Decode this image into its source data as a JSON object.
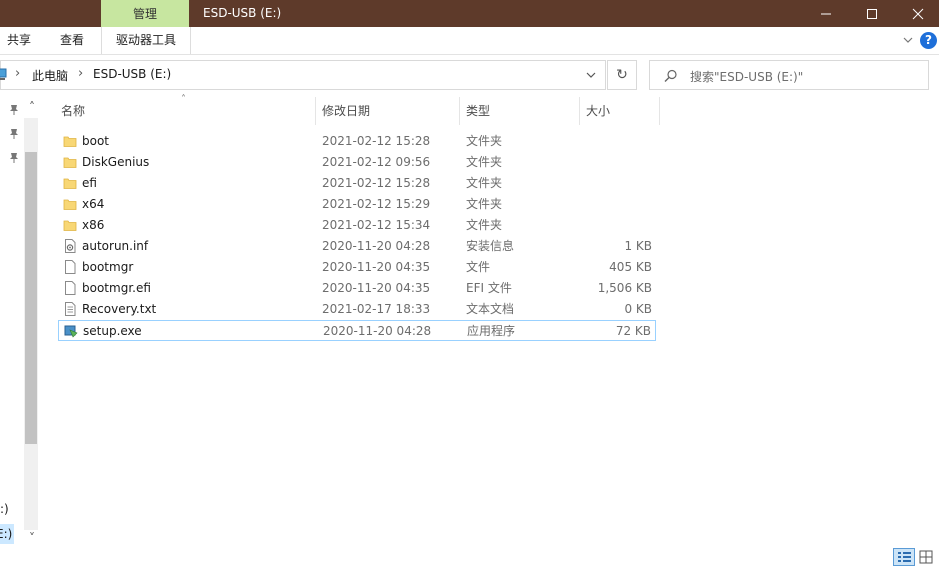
{
  "titlebar": {
    "context_tab": "管理",
    "title": "ESD-USB (E:)",
    "minimize": "—",
    "maximize": "☐",
    "close": "✕"
  },
  "ribbon": {
    "tabs": [
      "共享",
      "查看",
      "驱动器工具"
    ],
    "help": "?",
    "expand": "∨"
  },
  "address": {
    "crumbs": [
      "此电脑",
      "ESD-USB (E:)"
    ],
    "sep": "›",
    "dropdown": "∨",
    "refresh": "↻",
    "search_placeholder": "搜索\"ESD-USB (E:)\""
  },
  "nav": {
    "partial_items": [
      ":)",
      "E:)"
    ],
    "scroll_up": "˄",
    "scroll_down": "˅"
  },
  "columns": {
    "name": "名称",
    "date": "修改日期",
    "type": "类型",
    "size": "大小",
    "sort_arrow": "˄"
  },
  "files": [
    {
      "name": "boot",
      "date": "2021-02-12 15:28",
      "type": "文件夹",
      "size": "",
      "icon": "folder-icon"
    },
    {
      "name": "DiskGenius",
      "date": "2021-02-12 09:56",
      "type": "文件夹",
      "size": "",
      "icon": "folder-icon"
    },
    {
      "name": "efi",
      "date": "2021-02-12 15:28",
      "type": "文件夹",
      "size": "",
      "icon": "folder-icon"
    },
    {
      "name": "x64",
      "date": "2021-02-12 15:29",
      "type": "文件夹",
      "size": "",
      "icon": "folder-icon"
    },
    {
      "name": "x86",
      "date": "2021-02-12 15:34",
      "type": "文件夹",
      "size": "",
      "icon": "folder-icon"
    },
    {
      "name": "autorun.inf",
      "date": "2020-11-20 04:28",
      "type": "安装信息",
      "size": "1 KB",
      "icon": "settings-file-icon"
    },
    {
      "name": "bootmgr",
      "date": "2020-11-20 04:35",
      "type": "文件",
      "size": "405 KB",
      "icon": "file-icon"
    },
    {
      "name": "bootmgr.efi",
      "date": "2020-11-20 04:35",
      "type": "EFI 文件",
      "size": "1,506 KB",
      "icon": "file-icon"
    },
    {
      "name": "Recovery.txt",
      "date": "2021-02-17 18:33",
      "type": "文本文档",
      "size": "0 KB",
      "icon": "text-file-icon"
    },
    {
      "name": "setup.exe",
      "date": "2020-11-20 04:28",
      "type": "应用程序",
      "size": "72 KB",
      "icon": "setup-app-icon",
      "selected": true
    }
  ],
  "colors": {
    "titlebar": "#5e3a2a",
    "context_tab": "#c7e6a0",
    "folder": "#f8d775",
    "selection_border": "#99d1ff",
    "help": "#1e6fd9"
  }
}
